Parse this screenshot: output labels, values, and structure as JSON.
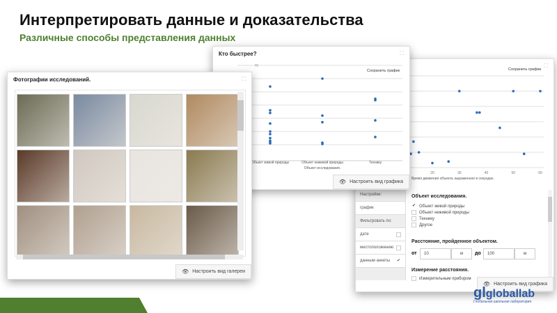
{
  "header": {
    "title": "Интерпретировать данные и доказательства",
    "subtitle": "Различные способы представления данных"
  },
  "gallery": {
    "title": "Фотографии исследований.",
    "button": "Настроить вид галереи",
    "thumbs": [
      "#6b6b55",
      "#7a8aa0",
      "#d8d8d0",
      "#b08a60",
      "#5a3a28",
      "#d0c8c0",
      "#e8e4e0",
      "#8a7a50",
      "#a09080",
      "#b0a090",
      "#c8b8a0",
      "#6a5a48"
    ]
  },
  "chart1": {
    "title": "Кто быстрее?",
    "save": "Сохранить график",
    "button": "Настроить вид графика"
  },
  "chart2": {
    "save": "Сохранить график",
    "button": "Настроить вид графика"
  },
  "settings": {
    "side": [
      {
        "label": "Настройки:"
      },
      {
        "label": "график"
      },
      {
        "label": "Фильтровать по:"
      },
      {
        "label": "дате",
        "checked": false
      },
      {
        "label": "местоположению",
        "checked": false
      },
      {
        "label": "данным анкеты",
        "checked": true
      }
    ],
    "object_title": "Объект исследования.",
    "options": [
      {
        "label": "Объект живой природы",
        "checked": true
      },
      {
        "label": "Объект неживой природы",
        "checked": false
      },
      {
        "label": "Технику",
        "checked": false
      },
      {
        "label": "Другое",
        "checked": false
      }
    ],
    "distance_title": "Расстояние, пройденное объектом.",
    "from_label": "от",
    "from_value": "10",
    "from_unit": "м",
    "to_label": "до",
    "to_value": "100",
    "to_unit": "м",
    "measure_title": "Измерение расстояния.",
    "measure_opt": "Измерительным прибором"
  },
  "logo": {
    "text": "globallab",
    "tagline": "Глобальная школьная лаборатория"
  },
  "chart_data": [
    {
      "type": "scatter",
      "title": "Кто быстрее?",
      "xlabel": "Объект исследования.",
      "ylabel": "",
      "categories": [
        "Объект живой природы",
        "Объект неживой природы",
        "Технику"
      ],
      "yticks": [
        70
      ],
      "ylim": [
        0,
        70
      ],
      "grid": true,
      "points": [
        [
          0,
          54
        ],
        [
          0,
          36
        ],
        [
          0,
          34
        ],
        [
          0,
          26
        ],
        [
          0,
          20
        ],
        [
          0,
          18
        ],
        [
          0,
          15
        ],
        [
          0,
          13
        ],
        [
          0,
          12
        ],
        [
          0,
          11
        ],
        [
          1,
          60
        ],
        [
          1,
          32
        ],
        [
          1,
          27
        ],
        [
          1,
          11.5
        ],
        [
          1,
          10.5
        ],
        [
          2,
          44.7
        ],
        [
          2,
          43.7
        ],
        [
          2,
          28.4
        ],
        [
          2,
          15.8
        ]
      ]
    },
    {
      "type": "scatter",
      "xlabel": "Время движения объекта, выраженное в секундах.",
      "ylabel": "",
      "xticks": [
        20,
        30,
        40,
        50,
        60
      ],
      "xlim": [
        12,
        60
      ],
      "grid": true,
      "points": [
        [
          12,
          9
        ],
        [
          13,
          17
        ],
        [
          15,
          10
        ],
        [
          20,
          3
        ],
        [
          26,
          4
        ],
        [
          30,
          50
        ],
        [
          36.5,
          36
        ],
        [
          37.5,
          36
        ],
        [
          45,
          26
        ],
        [
          50,
          50
        ],
        [
          54,
          9
        ],
        [
          60,
          50
        ]
      ]
    }
  ]
}
